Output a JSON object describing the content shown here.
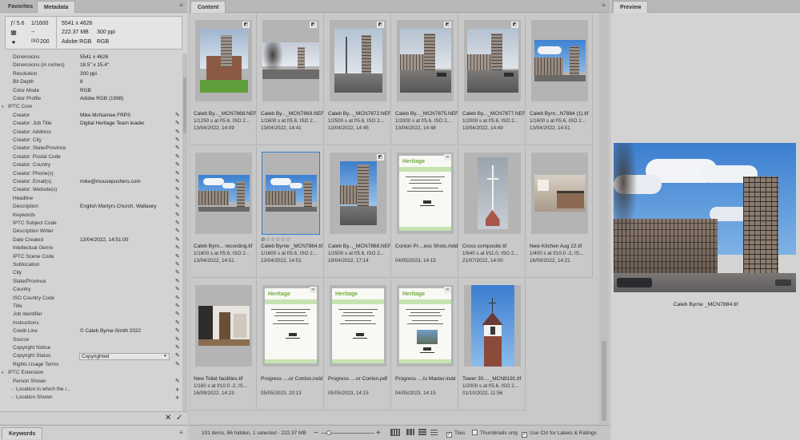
{
  "meta_panel": {
    "tabs": [
      "Favorites",
      "Metadata"
    ],
    "active_tab": "Metadata",
    "summary": {
      "aperture": "ƒ/ 5.6",
      "shutter": "1/1600",
      "exposure": "--",
      "iso_label": "ISO",
      "iso": "200",
      "dimensions": "5541 x 4626",
      "size": "222.37 MB",
      "ppi": "300 ppi",
      "profile": "Adobe RGB",
      "mode": "RGB"
    },
    "rows": [
      {
        "label": "Dimensions",
        "value": "5541 x 4626",
        "kind": "plain"
      },
      {
        "label": "Dimensions (in inches)",
        "value": "18.5\" x 15.4\"",
        "kind": "plain"
      },
      {
        "label": "Resolution",
        "value": "300 ppi",
        "kind": "plain"
      },
      {
        "label": "Bit Depth",
        "value": "8",
        "kind": "plain"
      },
      {
        "label": "Color Mode",
        "value": "RGB",
        "kind": "plain"
      },
      {
        "label": "Color Profile",
        "value": "Adobe RGB (1998)",
        "kind": "plain"
      },
      {
        "label": "IPTC Core",
        "value": "",
        "kind": "section"
      },
      {
        "label": "Creator",
        "value": "Mike McNamee FRPS",
        "kind": "edit"
      },
      {
        "label": "Creator: Job Title",
        "value": "Digital Heritage Team leader",
        "kind": "edit"
      },
      {
        "label": "Creator: Address",
        "value": "",
        "kind": "edit"
      },
      {
        "label": "Creator: City",
        "value": "",
        "kind": "edit"
      },
      {
        "label": "Creator: State/Province",
        "value": "",
        "kind": "edit"
      },
      {
        "label": "Creator: Postal Code",
        "value": "",
        "kind": "edit"
      },
      {
        "label": "Creator: Country",
        "value": "",
        "kind": "edit"
      },
      {
        "label": "Creator: Phone(s)",
        "value": "",
        "kind": "edit"
      },
      {
        "label": "Creator: Email(s)",
        "value": "mike@mousepushers.com",
        "kind": "edit"
      },
      {
        "label": "Creator: Website(s)",
        "value": "",
        "kind": "edit"
      },
      {
        "label": "Headline",
        "value": "",
        "kind": "edit"
      },
      {
        "label": "Description",
        "value": "English Martyrs Church, Wallasey",
        "kind": "edit"
      },
      {
        "label": "Keywords",
        "value": "",
        "kind": "edit"
      },
      {
        "label": "IPTC Subject Code",
        "value": "",
        "kind": "edit"
      },
      {
        "label": "Description Writer",
        "value": "",
        "kind": "edit"
      },
      {
        "label": "Date Created",
        "value": "13/04/2022, 14:51:00",
        "kind": "edit"
      },
      {
        "label": "Intellectual Genre",
        "value": "",
        "kind": "edit"
      },
      {
        "label": "IPTC Scene Code",
        "value": "",
        "kind": "edit"
      },
      {
        "label": "Sublocation",
        "value": "",
        "kind": "edit"
      },
      {
        "label": "City",
        "value": "",
        "kind": "edit"
      },
      {
        "label": "State/Province",
        "value": "",
        "kind": "edit"
      },
      {
        "label": "Country",
        "value": "",
        "kind": "edit"
      },
      {
        "label": "ISO Country Code",
        "value": "",
        "kind": "edit"
      },
      {
        "label": "Title",
        "value": "",
        "kind": "edit"
      },
      {
        "label": "Job Identifier",
        "value": "",
        "kind": "edit"
      },
      {
        "label": "Instructions",
        "value": "",
        "kind": "edit"
      },
      {
        "label": "Credit Line",
        "value": "© Caleb Byrne-Smith 2022",
        "kind": "edit"
      },
      {
        "label": "Source",
        "value": "",
        "kind": "edit"
      },
      {
        "label": "Copyright Notice",
        "value": "",
        "kind": "edit"
      },
      {
        "label": "Copyright Status",
        "value": "Copyrighted",
        "kind": "select"
      },
      {
        "label": "Rights Usage Terms",
        "value": "",
        "kind": "edit"
      },
      {
        "label": "IPTC Extension",
        "value": "",
        "kind": "section"
      },
      {
        "label": "Person Shown",
        "value": "",
        "kind": "edit"
      },
      {
        "label": "Location in which the i...",
        "value": "",
        "kind": "add"
      },
      {
        "label": "Location Shown",
        "value": "",
        "kind": "add"
      }
    ]
  },
  "keywords_panel": {
    "tab": "Keywords"
  },
  "content_panel": {
    "tab": "Content",
    "items": [
      {
        "name": "Caleb By..._MCN7868.NEF",
        "info": "1/1250 s at f/5.6, ISO 2...",
        "date": "13/04/2022, 14:09",
        "type": "photo1",
        "badge": "camera-raw-icon"
      },
      {
        "name": "Caleb By..._MCN7869.NEF",
        "info": "1/1600 s at f/5.6, ISO 2...",
        "date": "13/04/2022, 14:41",
        "type": "photo2",
        "badge": "camera-raw-icon"
      },
      {
        "name": "Caleb By..._MCN7872.NEF",
        "info": "1/2500 s at f/5.6, ISO 2...",
        "date": "13/04/2022, 14:45",
        "type": "photo3",
        "badge": "camera-raw-icon"
      },
      {
        "name": "Caleb By..._MCN7875.NEF",
        "info": "1/2000 s at f/5.6, ISO 2...",
        "date": "13/04/2022, 14:48",
        "type": "photo4",
        "badge": "camera-raw-icon"
      },
      {
        "name": "Caleb By..._MCN7877.NEF",
        "info": "1/2000 s at f/5.6, ISO 2...",
        "date": "13/04/2022, 14:49",
        "type": "photo4",
        "badge": "camera-raw-icon"
      },
      {
        "name": "Caleb Byrn...N7884 (1).tif",
        "info": "1/1600 s at f/5.6, ISO 2...",
        "date": "13/04/2022, 14:51",
        "type": "photo5",
        "badge": ""
      },
      {
        "name": "Caleb Byrn... recording.tif",
        "info": "1/1600 s at f/5.6, ISO 2...",
        "date": "13/04/2022, 14:51",
        "type": "photo6",
        "badge": ""
      },
      {
        "name": "Caleb Byrne _MCN7884.tif",
        "info": "1/1600 s at f/5.6, ISO 2...",
        "date": "13/04/2022, 14:51",
        "type": "photo6",
        "badge": "",
        "selected": true,
        "stars": "⊘☆☆☆☆☆"
      },
      {
        "name": "Caleb By..._MCN7888.NEF",
        "info": "1/2500 s at f/5.6, ISO 2...",
        "date": "19/04/2022, 17:14",
        "type": "photo7",
        "badge": "camera-raw-icon"
      },
      {
        "name": "Conlon Pr....ess Shots.indd",
        "info": "",
        "date": "04/05/2023, 14:15",
        "type": "doc",
        "badge": "link-icon"
      },
      {
        "name": "Cross composite.tif",
        "info": "1/640 s at f/11.0, ISO 2...",
        "date": "21/07/2022, 14:00",
        "type": "cross",
        "badge": ""
      },
      {
        "name": "New Kitchen Aug 22.tif",
        "info": "1/400 s at f/10.0 -2, IS...",
        "date": "16/09/2022, 14:21",
        "type": "kitchen",
        "badge": ""
      },
      {
        "name": "New Toilet facilities.tif",
        "info": "1/160 s at f/10.0 -2, IS...",
        "date": "16/09/2022, 14:23",
        "type": "toilet",
        "badge": ""
      },
      {
        "name": "Progress ....or Conlon.indd",
        "info": "",
        "date": "05/05/2023, 20:13",
        "type": "doc2",
        "badge": "link-icon"
      },
      {
        "name": "Progress ....or Conlon.pdf",
        "info": "",
        "date": "05/05/2023, 14:15",
        "type": "doc3",
        "badge": ""
      },
      {
        "name": "Progress ....ts Master.indd",
        "info": "",
        "date": "04/05/2023, 14:15",
        "type": "doc4",
        "badge": "link-icon"
      },
      {
        "name": "Tower 30...._MCN9191.tif",
        "info": "1/2000 s at f/5.6, ISO 2...",
        "date": "01/10/2022, 11:56",
        "type": "tower",
        "badge": ""
      }
    ],
    "status": {
      "count": "101 items, 86 hidden, 1 selected - 222.37 MB",
      "tiles_label": "Tiles",
      "thumbs_only_label": "Thumbnails only",
      "ctrl_label": "Use Ctrl for Labels & Ratings"
    }
  },
  "preview_panel": {
    "tab": "Preview",
    "caption": "Caleb Byrne _MCN7884.tif"
  }
}
